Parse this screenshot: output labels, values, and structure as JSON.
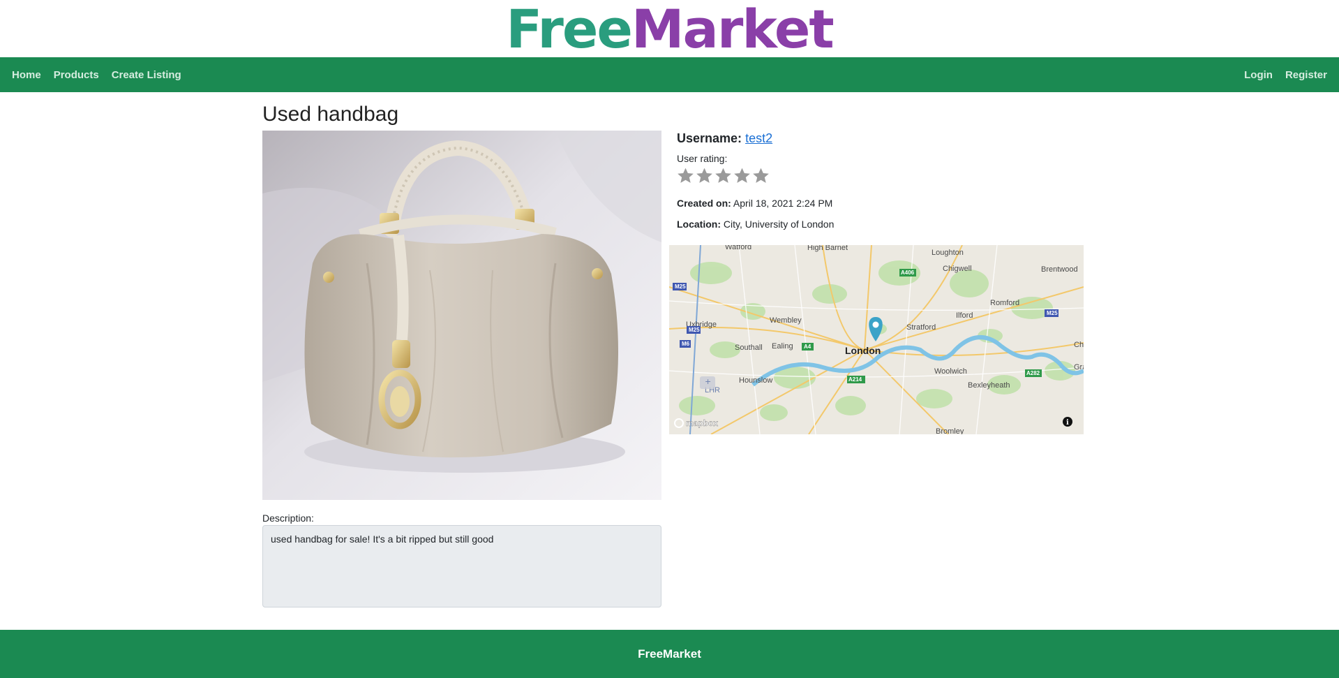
{
  "brand": {
    "logo_part1": "Free",
    "logo_part2": "Market",
    "logo_color1": "#2a9d7e",
    "logo_color2": "#8a3fa8"
  },
  "nav": {
    "left": [
      {
        "label": "Home"
      },
      {
        "label": "Products"
      },
      {
        "label": "Create Listing"
      }
    ],
    "right": [
      {
        "label": "Login"
      },
      {
        "label": "Register"
      }
    ],
    "background": "#1b8a52"
  },
  "listing": {
    "title": "Used handbag",
    "image_alt": "handbag-photo",
    "description_label": "Description:",
    "description": "used handbag for sale! It's a bit ripped but still good"
  },
  "seller": {
    "username_label": "Username:",
    "username": "test2",
    "rating_label": "User rating:",
    "rating": 0,
    "rating_max": 5,
    "created_label": "Created on:",
    "created_value": "April 18, 2021 2:24 PM",
    "location_label": "Location:",
    "location_value": "City, University of London"
  },
  "map": {
    "places": [
      "Watford",
      "High Barnet",
      "Loughton",
      "Chigwell",
      "Brentwood",
      "Romford",
      "Wembley",
      "Ilford",
      "Uxbridge",
      "Stratford",
      "Southall",
      "Ealing",
      "London",
      "Hounslow",
      "Woolwich",
      "Bexleyheath",
      "LHR",
      "Bromley"
    ],
    "roads": [
      "M25",
      "A406",
      "M25",
      "M6",
      "A4",
      "A214",
      "A282",
      "M25"
    ],
    "attribution": "mapbox"
  },
  "footer": {
    "text": "FreeMarket"
  }
}
